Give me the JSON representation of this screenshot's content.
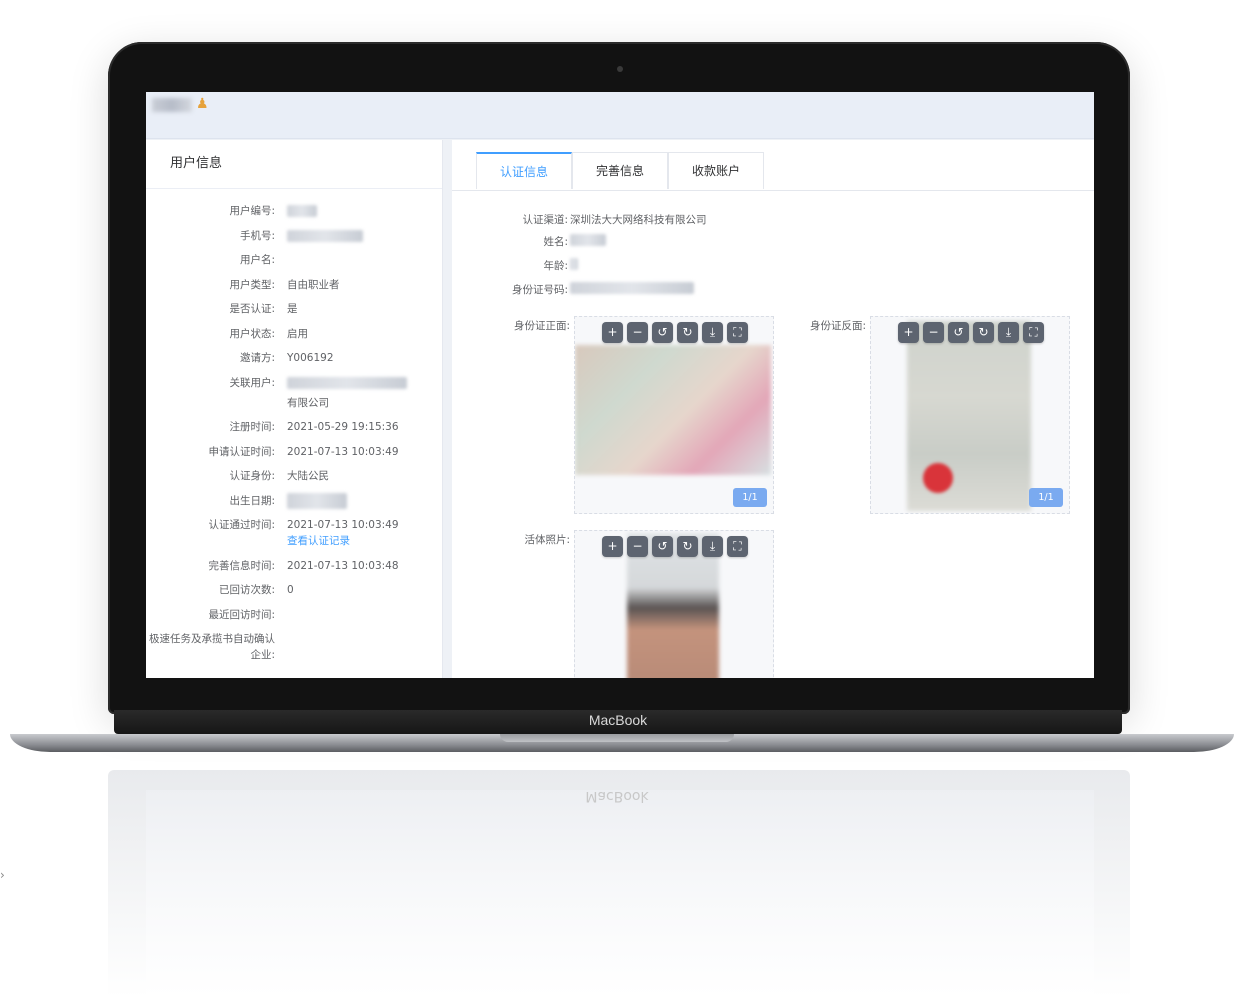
{
  "device": {
    "label": "MacBook"
  },
  "left_panel": {
    "title": "用户信息",
    "rows": [
      {
        "label": "用户编号:",
        "value": ""
      },
      {
        "label": "手机号:",
        "value": ""
      },
      {
        "label": "用户名:",
        "value": ""
      },
      {
        "label": "用户类型:",
        "value": "自由职业者"
      },
      {
        "label": "是否认证:",
        "value": "是"
      },
      {
        "label": "用户状态:",
        "value": "启用"
      },
      {
        "label": "邀请方:",
        "value": "Y006192"
      },
      {
        "label": "关联用户:",
        "value": "有限公司"
      },
      {
        "label": "注册时间:",
        "value": "2021-05-29 19:15:36"
      },
      {
        "label": "申请认证时间:",
        "value": "2021-07-13 10:03:49"
      },
      {
        "label": "认证身份:",
        "value": "大陆公民"
      },
      {
        "label": "出生日期:",
        "value": ""
      },
      {
        "label": "认证通过时间:",
        "value": "2021-07-13 10:03:49",
        "link": "查看认证记录"
      },
      {
        "label": "完善信息时间:",
        "value": "2021-07-13 10:03:48"
      },
      {
        "label": "已回访次数:",
        "value": "0"
      },
      {
        "label": "最近回访时间:",
        "value": ""
      },
      {
        "label": "极速任务及承揽书自动确认企业:",
        "value": ""
      }
    ]
  },
  "tabs": [
    {
      "label": "认证信息",
      "active": true
    },
    {
      "label": "完善信息",
      "active": false
    },
    {
      "label": "收款账户",
      "active": false
    }
  ],
  "cert_info": {
    "rows": [
      {
        "label": "认证渠道:",
        "value": "深圳法大大网络科技有限公司"
      },
      {
        "label": "姓名:",
        "value": ""
      },
      {
        "label": "年龄:",
        "value": ""
      },
      {
        "label": "身份证号码:",
        "value": ""
      }
    ],
    "images": [
      {
        "label": "身份证正面:",
        "page": "1/1"
      },
      {
        "label": "身份证反面:",
        "page": "1/1"
      },
      {
        "label": "活体照片:",
        "page": ""
      }
    ],
    "tools": [
      "zoom-in",
      "zoom-out",
      "rotate-left",
      "rotate-right",
      "download",
      "fullscreen"
    ],
    "tool_glyphs": [
      "+",
      "−",
      "↺",
      "↻",
      "⤓",
      "⛶"
    ]
  },
  "colors": {
    "accent": "#409eff",
    "page_badge": "#7aaaf0",
    "tool_button": "#5d6470"
  }
}
